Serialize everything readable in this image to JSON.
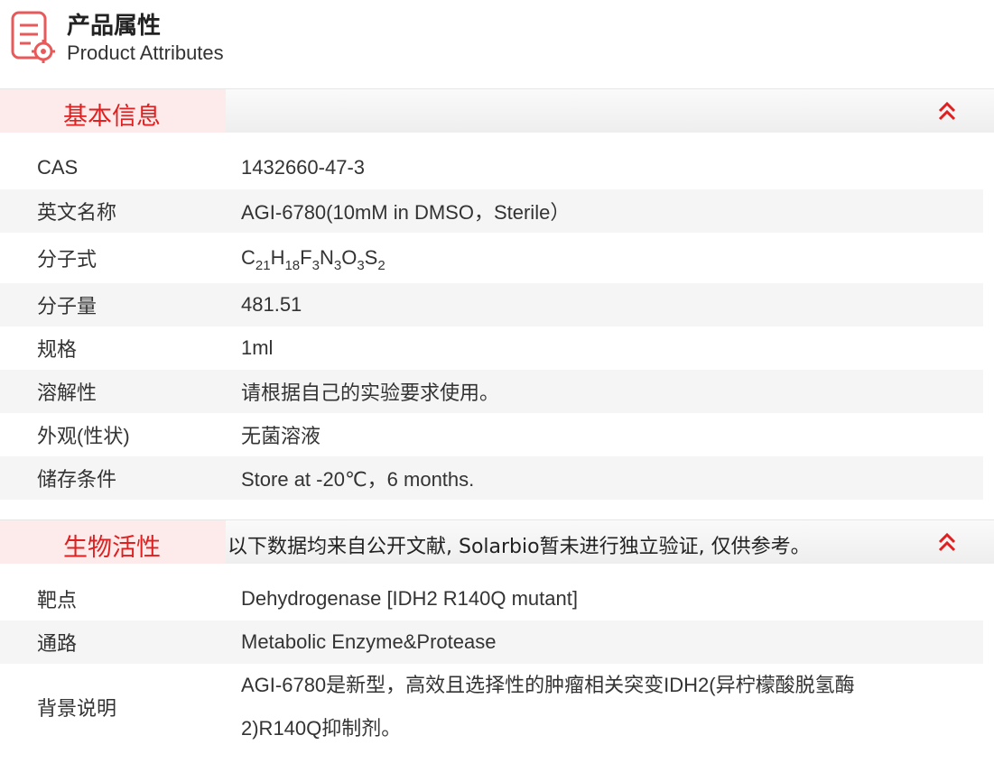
{
  "header": {
    "title_cn": "产品属性",
    "title_en": "Product Attributes",
    "icon": "document-gear-icon"
  },
  "colors": {
    "accent": "#e02020",
    "tab_bg": "#fdeaea",
    "alt_row": "#f5f5f5"
  },
  "basic_info": {
    "title": "基本信息",
    "toggle_icon": "double-chevron-up-icon",
    "rows": [
      {
        "label": "CAS",
        "value": "1432660-47-3"
      },
      {
        "label": "英文名称",
        "value": "AGI-6780(10mM in DMSO，Sterile）"
      },
      {
        "label": "分子式",
        "formula": [
          {
            "t": "C"
          },
          {
            "s": "21"
          },
          {
            "t": "H"
          },
          {
            "s": "18"
          },
          {
            "t": "F"
          },
          {
            "s": "3"
          },
          {
            "t": "N"
          },
          {
            "s": "3"
          },
          {
            "t": "O"
          },
          {
            "s": "3"
          },
          {
            "t": "S"
          },
          {
            "s": "2"
          }
        ]
      },
      {
        "label": "分子量",
        "value": "481.51"
      },
      {
        "label": "规格",
        "value": "1ml"
      },
      {
        "label": "溶解性",
        "value": "请根据自己的实验要求使用。"
      },
      {
        "label": "外观(性状)",
        "value": "无菌溶液"
      },
      {
        "label": "储存条件",
        "value": "Store at -20℃，6 months."
      }
    ]
  },
  "bio_activity": {
    "title": "生物活性",
    "note": "以下数据均来自公开文献, Solarbio暂未进行独立验证, 仅供参考。",
    "toggle_icon": "double-chevron-up-icon",
    "rows": [
      {
        "label": "靶点",
        "value": "Dehydrogenase [IDH2 R140Q mutant]"
      },
      {
        "label": "通路",
        "value": "Metabolic Enzyme&Protease"
      },
      {
        "label": "背景说明",
        "line1": "AGI-6780是新型，高效且选择性的肿瘤相关突变IDH2(异柠檬酸脱氢酶",
        "line2": "2)R140Q抑制剂。"
      }
    ]
  }
}
